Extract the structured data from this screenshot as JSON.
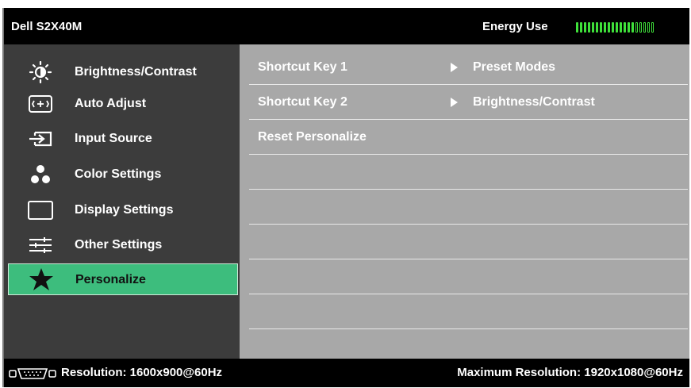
{
  "header": {
    "model": "Dell S2X40M",
    "energy_label": "Energy Use",
    "energy_level": {
      "filled": 15,
      "total": 20
    }
  },
  "menu": {
    "items": [
      {
        "label": "Brightness/Contrast",
        "icon": "brightness-icon"
      },
      {
        "label": "Auto Adjust",
        "icon": "auto-adjust-icon"
      },
      {
        "label": "Input Source",
        "icon": "input-source-icon"
      },
      {
        "label": "Color Settings",
        "icon": "color-settings-icon"
      },
      {
        "label": "Display Settings",
        "icon": "display-settings-icon"
      },
      {
        "label": "Other Settings",
        "icon": "other-settings-icon"
      },
      {
        "label": "Personalize",
        "icon": "star-icon",
        "selected": true
      }
    ]
  },
  "content": {
    "rows": [
      {
        "key": "Shortcut Key 1",
        "value": "Preset Modes"
      },
      {
        "key": "Shortcut Key 2",
        "value": "Brightness/Contrast"
      },
      {
        "key": "Reset Personalize",
        "value": ""
      }
    ]
  },
  "footer": {
    "resolution": "Resolution: 1600x900@60Hz",
    "max_resolution": "Maximum Resolution: 1920x1080@60Hz",
    "connector_icon": "vga-connector-icon"
  },
  "colors": {
    "selected": "#3dbd7d",
    "sidebar": "#3c3c3c",
    "content": "#a8a8a8",
    "energy": "#3fe13a"
  }
}
